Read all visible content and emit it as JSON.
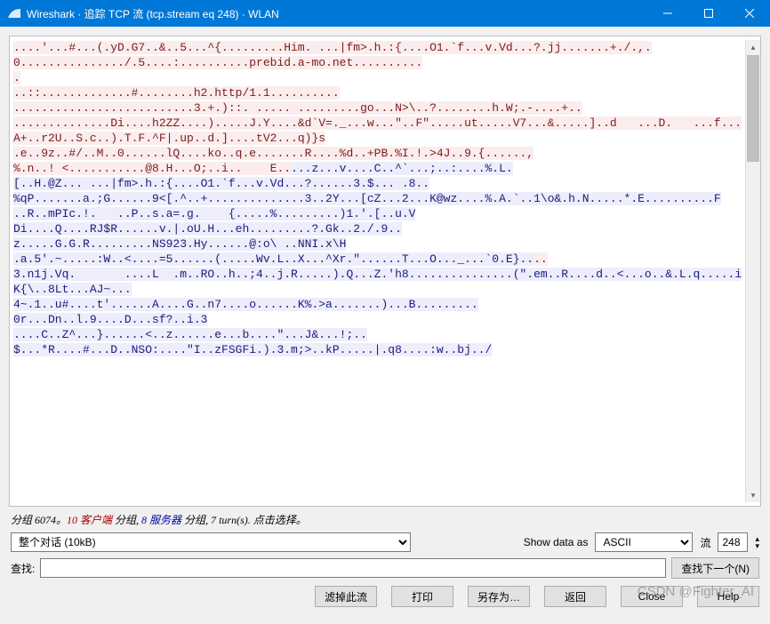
{
  "window": {
    "title": "Wireshark · 追踪 TCP 流 (tcp.stream eq 248) · WLAN"
  },
  "stream": {
    "client_block1": "....'...#...(.yD.G7..&..5...^{.........Him. ...|fm>.h.:{....O1.`f...v.Vd...?.jj.......+./.,.0.............../.5....:..........prebid.a-mo.net..........\n.\n..::.............#........h2.http/1.1..........\n..........................3.+.)::. ..... .........go...N>\\..?........h.W;.-....+..\n..............Di....h2ZZ....).....J.Y....&d`V=._...w...\"..F\".....ut.....V7...&.....]..d   ...D.   ...f...A+..r2U..S.c..).T.F.^F|.up..d.]....tV2...q)}s\n.e..9z..#/..M..0......lQ....ko..q.e.......R....%d..+PB.%I.!.>4J..9.{......,",
    "mixed_line1_c": "%.n..! <...........@8.H...O;..i..    E..",
    "mixed_line1_s": "...z...v....C..^`...;..:....%.L.",
    "server_block1": "[..H.@Z... ...|fm>.h.:{....O1.`f...v.Vd...?......3.$... .8..\n%qP.......a.;G......9<[.^..+..............3..2Y...[cZ...2...K@wz....%.A.`..1\\o&.h.N.....*.E..........F\n..R..mPIc.!.   ..P..s.a=.g.    {.....%.........)1.'.[..u.V\nDi....Q....RJ$R......v.|.oU.H...eh.........?.Gk..2./.9..\nz.....G.G.R.........NS923.Hy......@:o\\ ..NNI.x\\H",
    "mixed_line2_s": ".a.5'.~.....:W..<....=5......(.....Wv.L..X...^Xr.\"......T...O..._...`0.E}..",
    "mixed_line2_c": "..",
    "server_block2": "3.n1j.Vq.       ....L  .m..RO..h..;4..j.R.....).Q...Z.'h8...............(\".em..R....d..<...o..&.L.q.....iK{\\..8Lt...AJ~...\n4~.1..u#....t'......A....G..n7....o......K%.>a.......)...B.........\n0r...Dn..l.9....D...sf?..i.3\n....C..Z^...}......<..z......e...b....\"...J&...!;..\n$...*R....#...D..NSO:....\"I..zFSGFi.).3.m;>..kP.....|.q8....:w..bj../"
  },
  "stats": {
    "pre1": "分组 6074。",
    "client": "10 客户端",
    "mid1": " 分组, ",
    "server": "8 服务器",
    "post": " 分组, 7 turn(s). 点击选择。"
  },
  "controls": {
    "conversation": "整个对话 (10kB)",
    "show_as_label": "Show data as",
    "encoding": "ASCII",
    "stream_label": "流",
    "stream_num": "248",
    "find_label": "查找:",
    "find_next": "查找下一个(N)",
    "filter_out": "滤掉此流",
    "print": "打印",
    "save_as": "另存为…",
    "back": "返回",
    "close": "Close",
    "help": "Help"
  },
  "watermark": "CSDN @Fighter_AI"
}
